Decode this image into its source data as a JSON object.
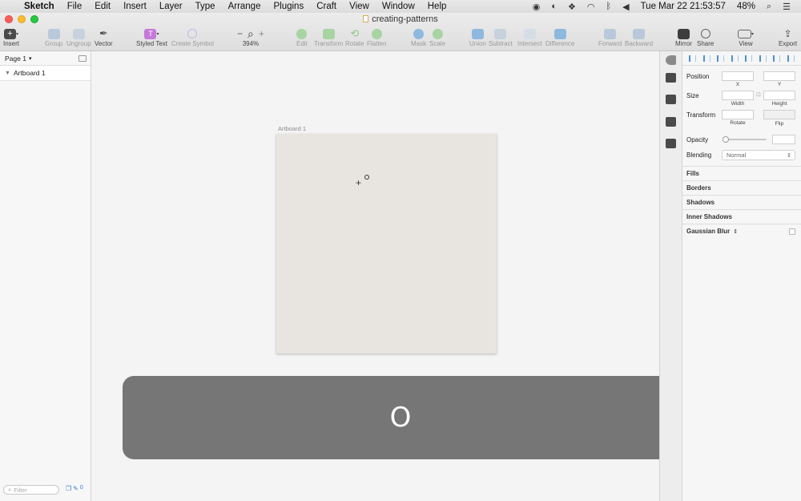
{
  "menubar": {
    "app": "Sketch",
    "menus": [
      "File",
      "Edit",
      "Insert",
      "Layer",
      "Type",
      "Arrange",
      "Plugins",
      "Craft",
      "View",
      "Window",
      "Help"
    ],
    "clock": "Tue Mar 22  21:53:57",
    "battery": "48%"
  },
  "window": {
    "title": "creating-patterns"
  },
  "toolbar": {
    "insert": "Insert",
    "group": "Group",
    "ungroup": "Ungroup",
    "vector": "Vector",
    "styled_text": "Styled Text",
    "create_symbol": "Create Symbol",
    "zoom_level": "394%",
    "edit": "Edit",
    "transform": "Transform",
    "rotate": "Rotate",
    "flatten": "Flatten",
    "mask": "Mask",
    "scale": "Scale",
    "union": "Union",
    "subtract": "Subtract",
    "intersect": "Intersect",
    "difference": "Difference",
    "forward": "Forward",
    "backward": "Backward",
    "mirror": "Mirror",
    "share": "Share",
    "view": "View",
    "export": "Export"
  },
  "left_panel": {
    "page": "Page 1",
    "layers": [
      "Artboard 1"
    ],
    "filter_placeholder": "Filter",
    "filter_count": "0"
  },
  "canvas": {
    "artboard_label": "Artboard 1",
    "key_overlay": "O"
  },
  "inspector": {
    "position": "Position",
    "x": "X",
    "y": "Y",
    "size": "Size",
    "width": "Width",
    "height": "Height",
    "transform": "Transform",
    "rotate": "Rotate",
    "flip": "Flip",
    "opacity": "Opacity",
    "blending": "Blending",
    "blending_value": "Normal",
    "sections": [
      "Fills",
      "Borders",
      "Shadows",
      "Inner Shadows",
      "Gaussian Blur"
    ]
  },
  "colors": {
    "artboard_fill": "#e8e5e1",
    "accent": "#4a90e2",
    "overlay": "#646464"
  }
}
